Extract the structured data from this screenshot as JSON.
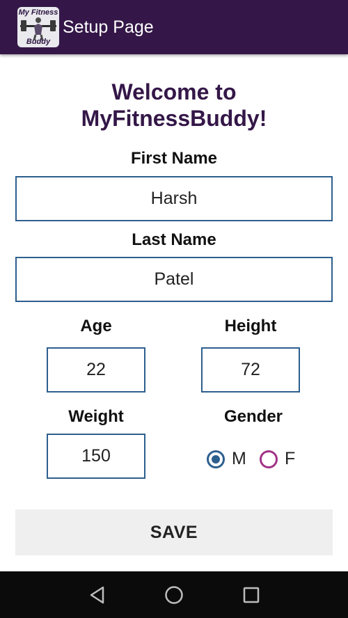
{
  "app_bar": {
    "logo_text_top": "My Fitness",
    "logo_text_bottom": "Buddy",
    "title": "Setup Page",
    "color": "#341748"
  },
  "welcome": {
    "line1": "Welcome to",
    "line2": "MyFitnessBuddy!"
  },
  "form": {
    "first_name": {
      "label": "First Name",
      "value": "Harsh"
    },
    "last_name": {
      "label": "Last Name",
      "value": "Patel"
    },
    "age": {
      "label": "Age",
      "value": "22"
    },
    "height": {
      "label": "Height",
      "value": "72"
    },
    "weight": {
      "label": "Weight",
      "value": "150"
    },
    "gender": {
      "label": "Gender",
      "options": [
        "M",
        "F"
      ],
      "selected": "M"
    }
  },
  "save_label": "SAVE",
  "colors": {
    "accent": "#341748",
    "input_border": "#2d5f8e",
    "radio_checked": "#2d5f8e",
    "radio_unchecked": "#a03287"
  },
  "nav_icons": [
    "back-icon",
    "home-icon",
    "recents-icon"
  ]
}
